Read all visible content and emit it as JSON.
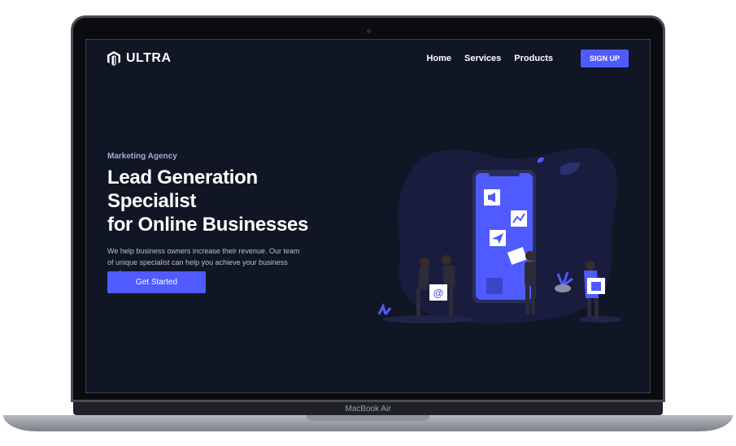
{
  "device": {
    "label": "MacBook Air"
  },
  "nav": {
    "brand": "ULTRA",
    "links": [
      "Home",
      "Services",
      "Products"
    ],
    "signup_label": "SIGN UP"
  },
  "hero": {
    "eyebrow": "Marketing Agency",
    "headline_line1": "Lead Generation Specialist",
    "headline_line2": "for Online Businesses",
    "description": "We help business owners increase their revenue. Our team of unique specialist can help you achieve your business goals.",
    "cta_label": "Get Started"
  },
  "illustration": {
    "badge_symbol": "@"
  },
  "colors": {
    "background": "#111624",
    "accent": "#4f5bff",
    "blob": "#191c3d"
  }
}
